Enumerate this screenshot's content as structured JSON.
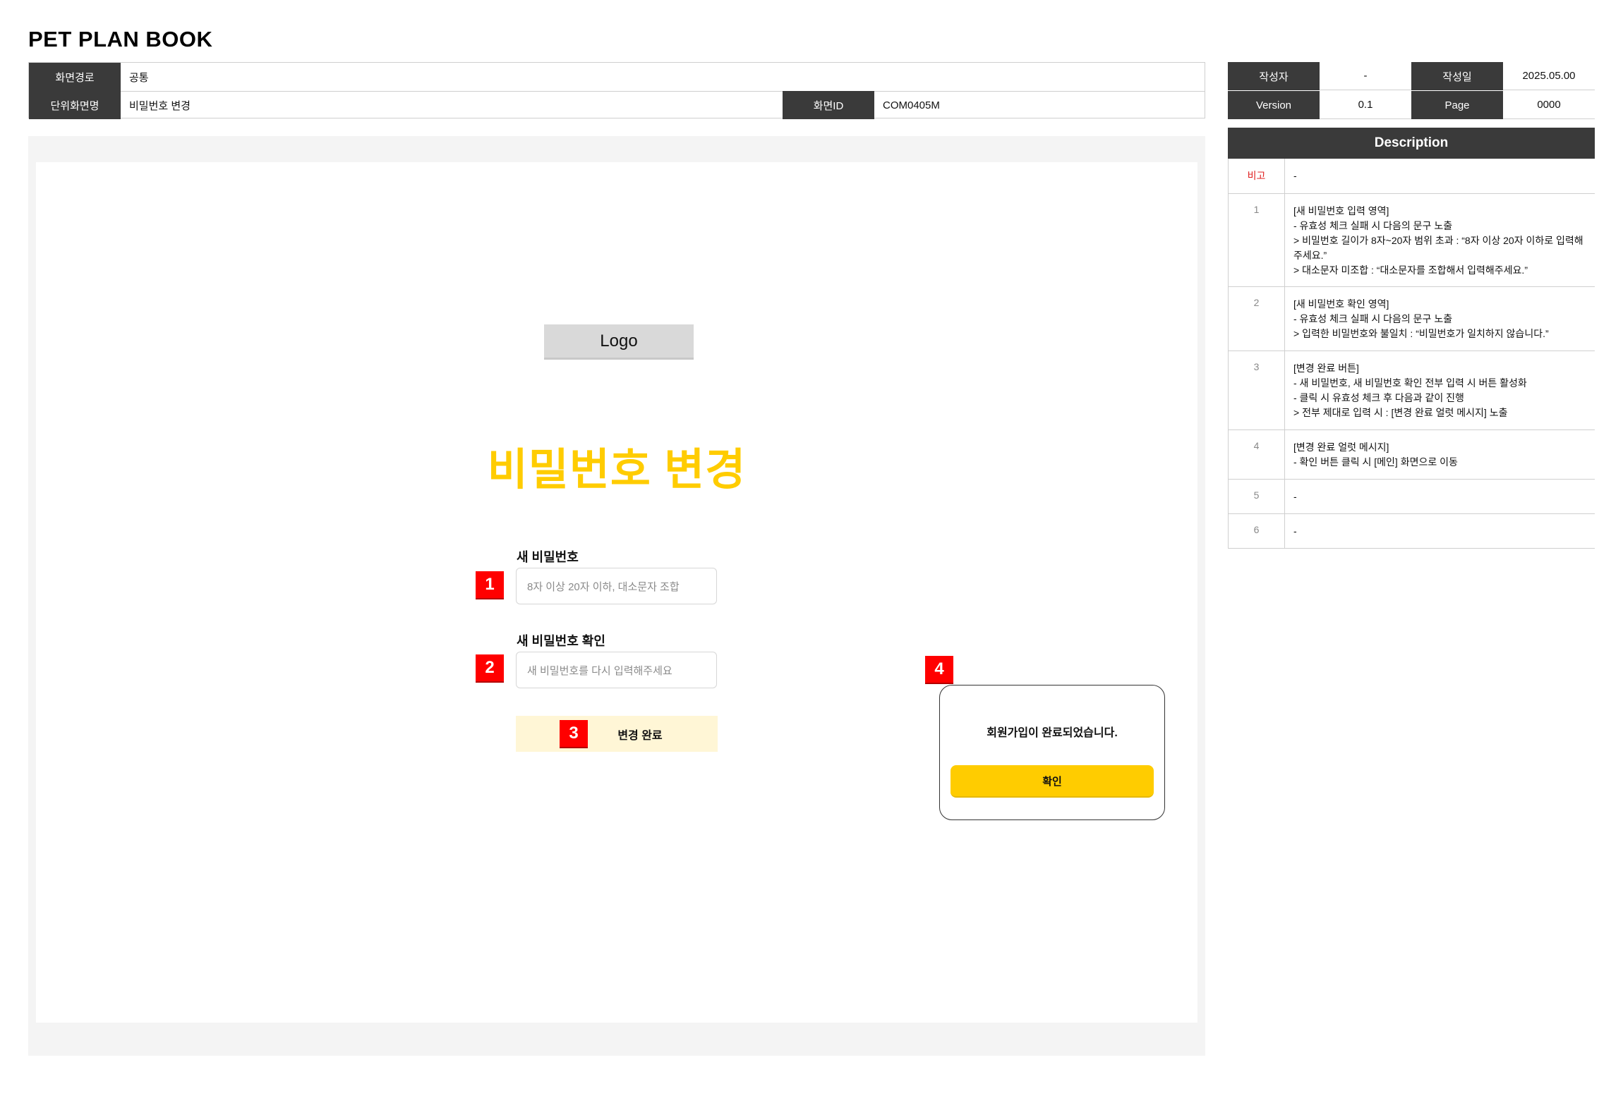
{
  "document": {
    "title": "PET PLAN BOOK"
  },
  "meta_left": {
    "path_label": "화면경로",
    "path_value": "공통",
    "screen_name_label": "단위화면명",
    "screen_name_value": "비밀번호 변경",
    "screen_id_label": "화면ID",
    "screen_id_value": "COM0405M"
  },
  "meta_right": {
    "author_label": "작성자",
    "author_value": "-",
    "date_label": "작성일",
    "date_value": "2025.05.00",
    "version_label": "Version",
    "version_value": "0.1",
    "page_label": "Page",
    "page_value": "0000"
  },
  "screen": {
    "logo": "Logo",
    "heading": "비밀번호 변경",
    "new_password_label": "새 비밀번호",
    "new_password_placeholder": "8자 이상 20자 이하, 대소문자 조합",
    "confirm_password_label": "새 비밀번호 확인",
    "confirm_password_placeholder": "새 비밀번호를 다시 입력해주세요",
    "submit_label": "변경 완료",
    "alert_message": "회원가입이 완료되었습니다.",
    "alert_confirm": "확인"
  },
  "markers": [
    "1",
    "2",
    "3",
    "4"
  ],
  "colors": {
    "accent_yellow": "#FFCC00",
    "marker_red": "#FF0000",
    "header_dark": "#3A3A3A",
    "submit_bg": "#FFF6D6"
  },
  "description": {
    "title": "Description",
    "rows": [
      {
        "num": "비고",
        "text": "-"
      },
      {
        "num": "1",
        "text": "[새 비밀번호 입력 영역]\n- 유효성 체크 실패 시 다음의 문구 노출\n  > 비밀번호 길이가 8자~20자 범위 초과 : “8자 이상 20자 이하로 입력해주세요.”\n  > 대소문자 미조합 : “대소문자를 조합해서 입력해주세요.”"
      },
      {
        "num": "2",
        "text": "[새 비밀번호 확인 영역]\n- 유효성 체크 실패 시 다음의 문구 노출\n  > 입력한 비밀번호와 불일치 : “비밀번호가 일치하지 않습니다.”"
      },
      {
        "num": "3",
        "text": "[변경 완료 버튼]\n- 새 비밀번호, 새 비밀번호 확인 전부 입력 시 버튼 활성화\n- 클릭 시 유효성 체크 후 다음과 같이 진행\n  > 전부 제대로 입력 시 : [변경 완료 얼럿 메시지] 노출"
      },
      {
        "num": "4",
        "text": "[변경 완료 얼럿 메시지]\n- 확인 버튼 클릭 시 [메인] 화면으로 이동"
      },
      {
        "num": "5",
        "text": "-"
      },
      {
        "num": "6",
        "text": "-"
      }
    ]
  }
}
